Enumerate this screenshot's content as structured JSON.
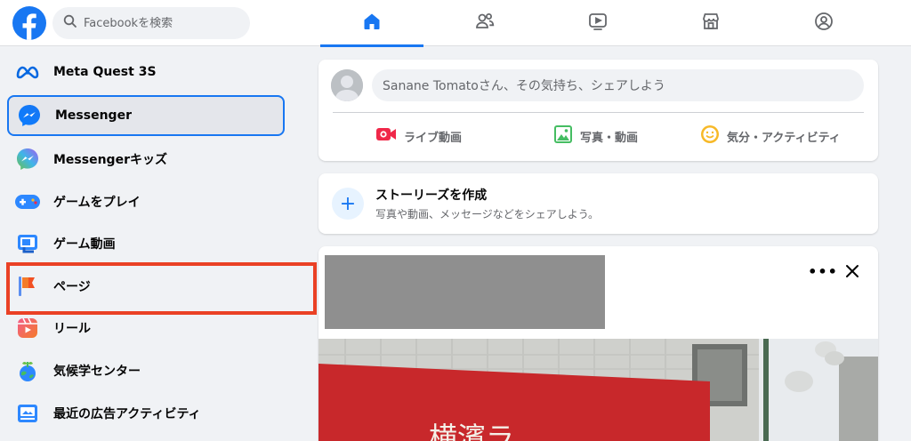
{
  "header": {
    "logo": "facebook-logo",
    "search_placeholder": "Facebookを検索",
    "nav_tabs": [
      {
        "name": "home",
        "icon": "home-icon",
        "active": true
      },
      {
        "name": "friends",
        "icon": "friends-icon",
        "active": false
      },
      {
        "name": "watch",
        "icon": "video-icon",
        "active": false
      },
      {
        "name": "marketplace",
        "icon": "marketplace-icon",
        "active": false
      },
      {
        "name": "groups",
        "icon": "groups-icon",
        "active": false
      }
    ]
  },
  "sidebar": {
    "items": [
      {
        "label": "Meta Quest 3S",
        "icon": "meta-icon"
      },
      {
        "label": "Messenger",
        "icon": "messenger-icon",
        "selected": true
      },
      {
        "label": "Messengerキッズ",
        "icon": "messenger-kids-icon"
      },
      {
        "label": "ゲームをプレイ",
        "icon": "gamepad-icon"
      },
      {
        "label": "ゲーム動画",
        "icon": "gaming-video-icon"
      },
      {
        "label": "ページ",
        "icon": "flag-icon",
        "highlighted": true
      },
      {
        "label": "リール",
        "icon": "reels-icon"
      },
      {
        "label": "気候学センター",
        "icon": "climate-icon"
      },
      {
        "label": "最近の広告アクティビティ",
        "icon": "ad-activity-icon"
      }
    ]
  },
  "composer": {
    "placeholder": "Sanane Tomatoさん、その気持ち、シェアしよう",
    "actions": [
      {
        "label": "ライブ動画",
        "icon": "live-video-icon",
        "color": "#f02849"
      },
      {
        "label": "写真・動画",
        "icon": "photo-icon",
        "color": "#45bd62"
      },
      {
        "label": "気分・アクティビティ",
        "icon": "feeling-icon",
        "color": "#f7b928"
      }
    ]
  },
  "story": {
    "title": "ストーリーズを作成",
    "subtitle": "写真や動画、メッセージなどをシェアしよう。"
  },
  "post": {
    "more_icon": "more-icon",
    "close_icon": "close-icon",
    "photo_sign_text": "横濱ラ"
  },
  "colors": {
    "brand": "#1877f2",
    "highlight": "#ea4125",
    "background": "#f0f2f5"
  }
}
